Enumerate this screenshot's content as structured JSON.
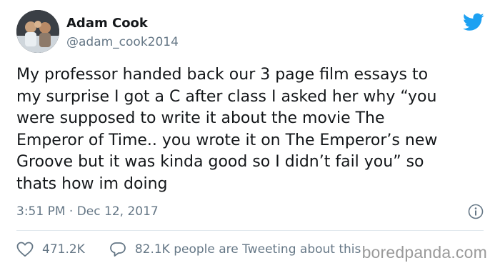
{
  "author": {
    "name": "Adam Cook",
    "handle": "@adam_cook2014"
  },
  "tweet": {
    "text": "My professor handed back our 3 page film essays to\nmy surprise I got a C after class I asked her why  “you\nwere supposed to write it about the movie The\nEmperor of Time.. you wrote it on The Emperor’s new\nGroove but it was kinda good so I didn’t fail you” so\nthats how im doing",
    "timestamp": "3:51 PM · Dec 12, 2017"
  },
  "stats": {
    "likes": "471.2K",
    "conversation": "82.1K people are Tweeting about this"
  },
  "icons": {
    "bird": "twitter-bird-icon",
    "info": "info-icon",
    "like": "heart-icon",
    "reply": "speech-bubble-icon"
  },
  "colors": {
    "brand": "#1da1f2",
    "secondary_text": "#657786",
    "divider": "#e1e8ed"
  },
  "watermark": "boredpanda.com"
}
